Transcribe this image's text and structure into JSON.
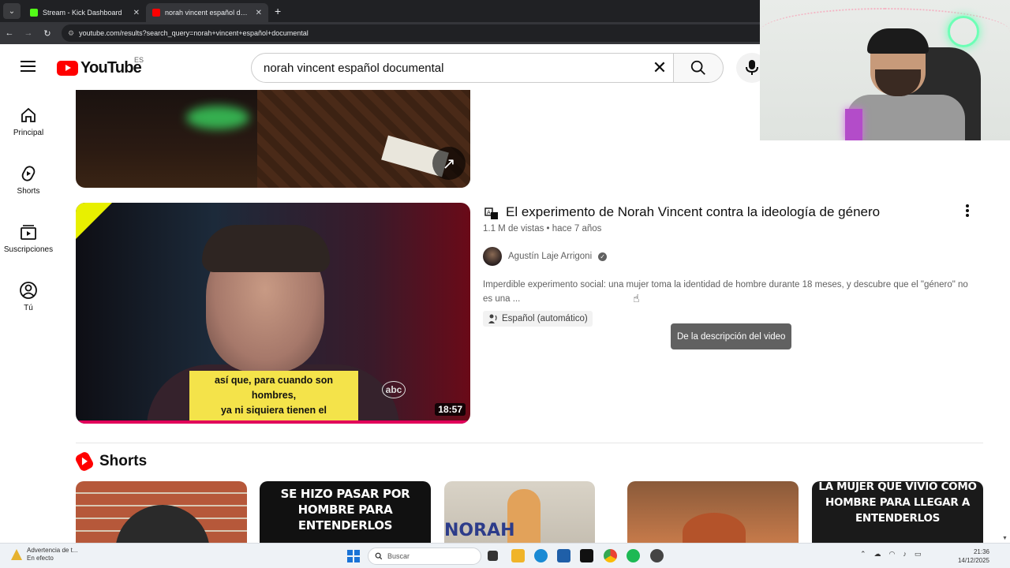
{
  "browser": {
    "tabs": [
      {
        "label": "Stream - Kick Dashboard",
        "favicon_color": "#53fc18",
        "active": false
      },
      {
        "label": "norah vincent español documental - YouTube",
        "favicon_color": "#ff0000",
        "active": true
      }
    ],
    "new_tab": "+",
    "url": "youtube.com/results?search_query=norah+vincent+español+documental"
  },
  "header": {
    "logo_text": "YouTube",
    "country_code": "ES",
    "search_value": "norah vincent español documental"
  },
  "sidebar": {
    "items": [
      {
        "label": "Principal",
        "icon": "home-icon"
      },
      {
        "label": "Shorts",
        "icon": "shorts-icon"
      },
      {
        "label": "Suscripciones",
        "icon": "subscriptions-icon"
      },
      {
        "label": "Tú",
        "icon": "you-icon"
      }
    ]
  },
  "result": {
    "title": "El experimento de Norah Vincent contra la ideología de género",
    "meta": "1.1 M de vistas • hace 7 años",
    "channel": "Agustín Laje Arrigoni",
    "description": "Imperdible experimento social: una mujer toma la identidad de hombre durante 18 meses, y descubre que el \"género\" no es una ...",
    "audio_chip": "Español (automático)",
    "tooltip": "De la descripción del video",
    "duration": "18:57",
    "caption_line1": "así que, para cuando son hombres,",
    "caption_line2": "ya ni siquiera tienen el vocabulario",
    "network_logo": "abc"
  },
  "shorts": {
    "heading": "Shorts",
    "items": [
      {
        "overlay": ""
      },
      {
        "overlay": "SE HIZO PASAR POR HOMBRE PARA ENTENDERLOS"
      },
      {
        "overlay": "NORAH"
      },
      {
        "overlay": ""
      },
      {
        "overlay": "LA MUJER QUE VIVIÓ COMO HOMBRE PARA LLEGAR A ENTENDERLOS"
      }
    ]
  },
  "taskbar": {
    "weather_line1": "Advertencia de t...",
    "weather_line2": "En efecto",
    "search_placeholder": "Buscar",
    "time": "21:36",
    "date": "14/12/2025"
  },
  "colors": {
    "youtube_red": "#ff0000",
    "progress": "#e1005a",
    "caption_bg": "#f4e34a"
  }
}
